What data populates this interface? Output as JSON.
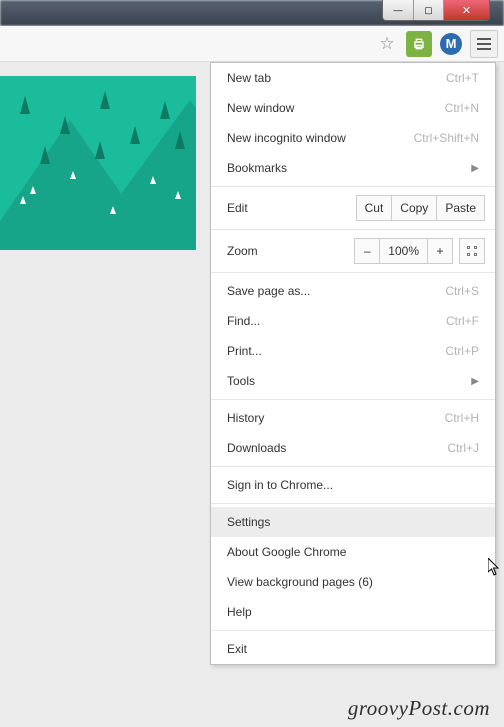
{
  "window": {
    "controls": {
      "min": "—",
      "max": "▢",
      "close": "✕"
    }
  },
  "toolbar": {
    "star": "☆",
    "ext_m_letter": "M"
  },
  "menu": {
    "new_tab": {
      "label": "New tab",
      "shortcut": "Ctrl+T"
    },
    "new_window": {
      "label": "New window",
      "shortcut": "Ctrl+N"
    },
    "new_incognito": {
      "label": "New incognito window",
      "shortcut": "Ctrl+Shift+N"
    },
    "bookmarks": {
      "label": "Bookmarks"
    },
    "edit": {
      "label": "Edit",
      "cut": "Cut",
      "copy": "Copy",
      "paste": "Paste"
    },
    "zoom": {
      "label": "Zoom",
      "minus": "–",
      "value": "100%",
      "plus": "+"
    },
    "save_as": {
      "label": "Save page as...",
      "shortcut": "Ctrl+S"
    },
    "find": {
      "label": "Find...",
      "shortcut": "Ctrl+F"
    },
    "print": {
      "label": "Print...",
      "shortcut": "Ctrl+P"
    },
    "tools": {
      "label": "Tools"
    },
    "history": {
      "label": "History",
      "shortcut": "Ctrl+H"
    },
    "downloads": {
      "label": "Downloads",
      "shortcut": "Ctrl+J"
    },
    "signin": {
      "label": "Sign in to Chrome..."
    },
    "settings": {
      "label": "Settings"
    },
    "about": {
      "label": "About Google Chrome"
    },
    "bg_pages": {
      "label": "View background pages (6)"
    },
    "help": {
      "label": "Help"
    },
    "exit": {
      "label": "Exit"
    }
  },
  "watermark": "groovyPost.com"
}
